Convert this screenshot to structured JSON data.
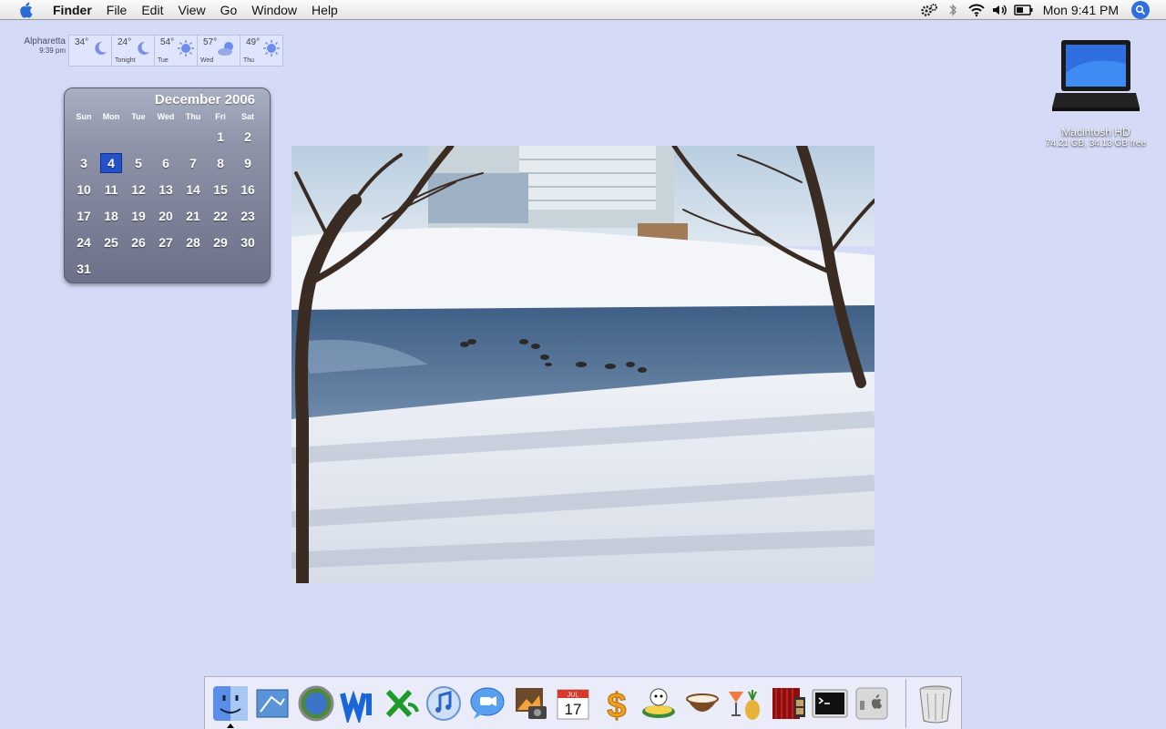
{
  "menubar": {
    "app_name": "Finder",
    "menus": [
      "File",
      "Edit",
      "View",
      "Go",
      "Window",
      "Help"
    ],
    "clock": "Mon 9:41 PM"
  },
  "weather": {
    "city": "Alpharetta",
    "time": "9:39 pm",
    "days": [
      {
        "temp": "34°",
        "label": "",
        "icon": "moon-icon"
      },
      {
        "temp": "24°",
        "label": "Tonight",
        "icon": "moon-icon"
      },
      {
        "temp": "54°",
        "label": "Tue",
        "icon": "sun-icon"
      },
      {
        "temp": "57°",
        "label": "Wed",
        "icon": "partly-cloudy-icon"
      },
      {
        "temp": "49°",
        "label": "Thu",
        "icon": "sun-icon"
      }
    ]
  },
  "calendar": {
    "title": "December 2006",
    "weekdays": [
      "Sun",
      "Mon",
      "Tue",
      "Wed",
      "Thu",
      "Fri",
      "Sat"
    ],
    "days": [
      "",
      "",
      "",
      "",
      "",
      "1",
      "2",
      "3",
      "4",
      "5",
      "6",
      "7",
      "8",
      "9",
      "10",
      "11",
      "12",
      "13",
      "14",
      "15",
      "16",
      "17",
      "18",
      "19",
      "20",
      "21",
      "22",
      "23",
      "24",
      "25",
      "26",
      "27",
      "28",
      "29",
      "30",
      "31",
      "",
      "",
      "",
      "",
      "",
      ""
    ],
    "today": "4"
  },
  "drive": {
    "name": "Macintosh HD",
    "info": "74.21 GB, 34.13 GB free"
  },
  "dock": {
    "apps": [
      "Finder",
      "Mail",
      "Safari",
      "Word",
      "Excel",
      "iTunes",
      "iChat",
      "iPhoto",
      "iCal",
      "Budget",
      "Toast",
      "Coconut",
      "Cocktail",
      "Slideshow",
      "Terminal",
      "System Preferences"
    ],
    "trash": "Trash",
    "calendar_icon_month": "JUL",
    "calendar_icon_day": "17"
  },
  "colors": {
    "desktop": "#d5dbf7",
    "today_highlight": "#2450c8"
  }
}
